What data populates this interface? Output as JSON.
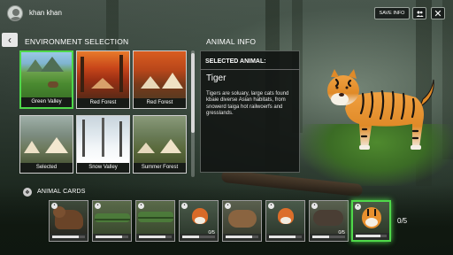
{
  "user": {
    "name": "khan khan"
  },
  "topbar": {
    "save_label": "SAVE INFO",
    "people_icon": "people-icon",
    "close_icon": "close-icon"
  },
  "env": {
    "title": "ENVIRONMENT SELECTION",
    "cards": [
      {
        "label": "Green Valley",
        "selected": true
      },
      {
        "label": "Red Forest",
        "selected": false
      },
      {
        "label": "Red Forest",
        "selected": false
      },
      {
        "label": "Selected",
        "selected": false
      },
      {
        "label": "Snow Valley",
        "selected": false
      },
      {
        "label": "Summer Forest",
        "selected": false
      }
    ]
  },
  "info": {
    "title": "ANIMAL INFO",
    "selected_label": "SELECTED ANIMAL:",
    "animal_name": "Tiger",
    "description": "Tigers are soluary, large cats found kbaie diverse Asian habitats, from snowerd taiga hot railwoerfs and gresslands."
  },
  "cards": {
    "title": "ANIMAL CARDS",
    "items": [
      {
        "animal": "bear",
        "count": "",
        "progress": 0.8,
        "active": false
      },
      {
        "animal": "crocodile",
        "count": "",
        "progress": 0.8,
        "active": false
      },
      {
        "animal": "crocodile",
        "count": "",
        "progress": 0.8,
        "active": false
      },
      {
        "animal": "fox",
        "count": "0/5",
        "progress": 0.5,
        "active": false
      },
      {
        "animal": "capybara",
        "count": "",
        "progress": 0.8,
        "active": false
      },
      {
        "animal": "fox",
        "count": "",
        "progress": 0.8,
        "active": false
      },
      {
        "animal": "boar",
        "count": "0/5",
        "progress": 0.5,
        "active": false
      },
      {
        "animal": "tiger",
        "count": "",
        "progress": 0.8,
        "active": true
      }
    ],
    "total": "0/5"
  },
  "colors": {
    "select_green": "#4fd84a",
    "panel_bg": "#12161"
  }
}
